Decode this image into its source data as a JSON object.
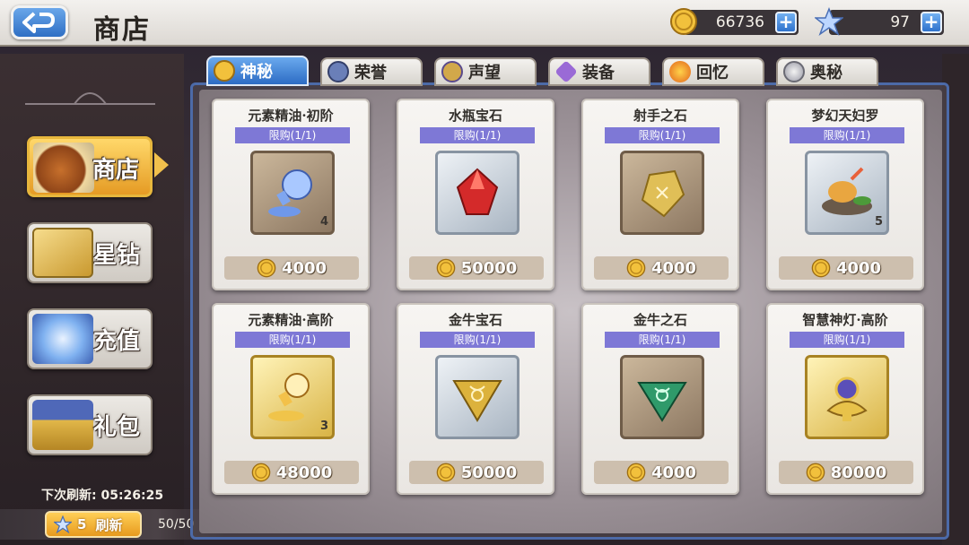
{
  "header": {
    "title": "商店",
    "back_icon": "back-arrow-icon",
    "gold": "66736",
    "stars": "97",
    "plus_label": "+"
  },
  "sidebar": {
    "items": [
      {
        "label": "商店",
        "icon": "roast-chicken-icon",
        "active": true
      },
      {
        "label": "星钻",
        "icon": "star-card-icon",
        "active": false
      },
      {
        "label": "充值",
        "icon": "crystal-star-icon",
        "active": false
      },
      {
        "label": "礼包",
        "icon": "treasure-chest-icon",
        "active": false
      }
    ],
    "refresh_text": "下次刷新: 05:26:25",
    "refresh_cost": "5",
    "refresh_label": "刷新",
    "refresh_count": "50/50"
  },
  "tabs": [
    {
      "label": "神秘",
      "icon": "gold-coin-icon",
      "active": true
    },
    {
      "label": "荣誉",
      "icon": "honor-emblem-icon",
      "active": false
    },
    {
      "label": "声望",
      "icon": "reputation-medal-icon",
      "active": false
    },
    {
      "label": "装备",
      "icon": "equipment-crystal-icon",
      "active": false
    },
    {
      "label": "回忆",
      "icon": "memory-orb-icon",
      "active": false
    },
    {
      "label": "奥秘",
      "icon": "arcane-orb-icon",
      "active": false
    }
  ],
  "items": [
    {
      "name": "元素精油·初阶",
      "limit": "限购(1/1)",
      "qty": "4",
      "price": "4000",
      "frame": "bronze",
      "icon": "potion-flask-icon"
    },
    {
      "name": "水瓶宝石",
      "limit": "限购(1/1)",
      "qty": "",
      "price": "50000",
      "frame": "silver",
      "icon": "red-gem-icon"
    },
    {
      "name": "射手之石",
      "limit": "限购(1/1)",
      "qty": "",
      "price": "4000",
      "frame": "bronze",
      "icon": "gold-stone-icon"
    },
    {
      "name": "梦幻天妇罗",
      "limit": "限购(1/1)",
      "qty": "5",
      "price": "4000",
      "frame": "silver",
      "icon": "tempura-dish-icon"
    },
    {
      "name": "元素精油·高阶",
      "limit": "限购(1/1)",
      "qty": "3",
      "price": "48000",
      "frame": "gold",
      "icon": "gold-potion-icon"
    },
    {
      "name": "金牛宝石",
      "limit": "限购(1/1)",
      "qty": "",
      "price": "50000",
      "frame": "silver",
      "icon": "taurus-gem-icon"
    },
    {
      "name": "金牛之石",
      "limit": "限购(1/1)",
      "qty": "",
      "price": "4000",
      "frame": "bronze",
      "icon": "green-stone-icon"
    },
    {
      "name": "智慧神灯·高阶",
      "limit": "限购(1/1)",
      "qty": "",
      "price": "80000",
      "frame": "gold",
      "icon": "magic-lamp-icon"
    }
  ],
  "colors": {
    "accent_blue": "#2f6fc4",
    "limit_purple": "#7e78d6",
    "gold": "#e7b73d"
  }
}
